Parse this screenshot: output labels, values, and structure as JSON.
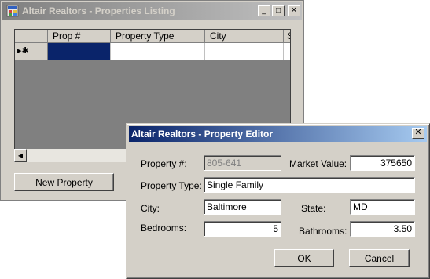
{
  "main_window": {
    "title": "Altair Realtors - Properties Listing",
    "min_glyph": "_",
    "max_glyph": "□",
    "close_glyph": "✕",
    "grid": {
      "columns": [
        "Prop #",
        "Property Type",
        "City",
        "S"
      ],
      "new_row_indicator": "▸✱",
      "rows": [
        [
          "",
          "",
          "",
          ""
        ]
      ]
    },
    "scroll_left_glyph": "◀",
    "new_property_label": "New Property"
  },
  "dialog": {
    "title": "Altair Realtors - Property Editor",
    "close_glyph": "✕",
    "property_number_label": "Property #:",
    "property_number_value": "805-641",
    "market_value_label": "Market Value:",
    "market_value_value": "375650",
    "property_type_label": "Property Type:",
    "property_type_value": "Single Family",
    "city_label": "City:",
    "city_value": "Baltimore",
    "state_label": "State:",
    "state_value": "MD",
    "bedrooms_label": "Bedrooms:",
    "bedrooms_value": "5",
    "bathrooms_label": "Bathrooms:",
    "bathrooms_value": "3.50",
    "ok_label": "OK",
    "cancel_label": "Cancel"
  },
  "colors": {
    "active_title_start": "#0a246a",
    "active_title_end": "#a6caf0",
    "inactive_title_start": "#808080",
    "window_face": "#d4d0c8",
    "grid_background": "#808080",
    "selected_cell": "#0a246a"
  }
}
